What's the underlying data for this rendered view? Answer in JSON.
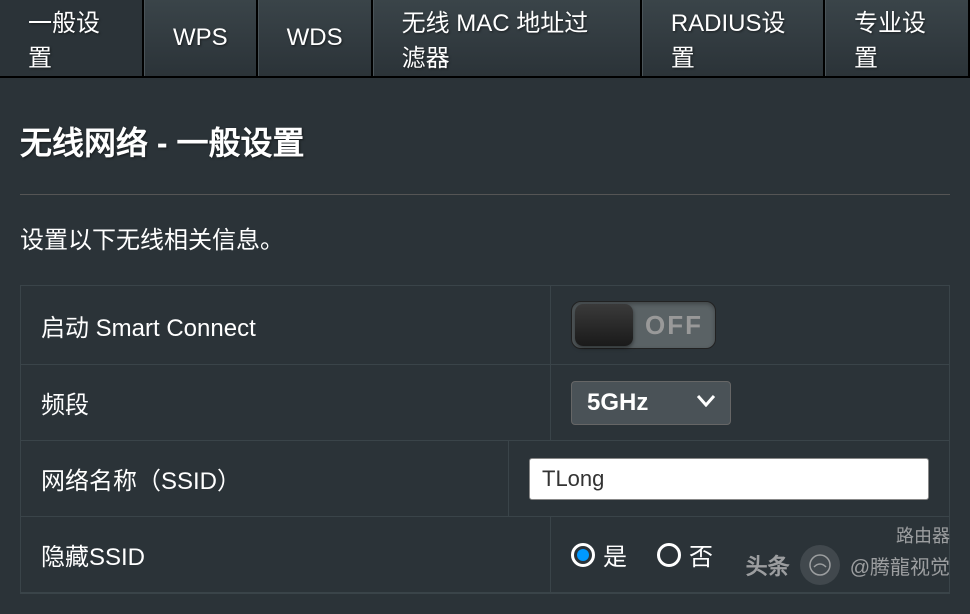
{
  "tabs": [
    {
      "label": "一般设置",
      "active": true
    },
    {
      "label": "WPS",
      "active": false
    },
    {
      "label": "WDS",
      "active": false
    },
    {
      "label": "无线 MAC 地址过滤器",
      "active": false
    },
    {
      "label": "RADIUS设置",
      "active": false
    },
    {
      "label": "专业设置",
      "active": false
    }
  ],
  "page": {
    "title": "无线网络 - 一般设置",
    "description": "设置以下无线相关信息。"
  },
  "settings": {
    "smartConnect": {
      "label": "启动 Smart Connect",
      "state": "OFF"
    },
    "band": {
      "label": "频段",
      "value": "5GHz"
    },
    "ssid": {
      "label": "网络名称（SSID）",
      "value": "TLong"
    },
    "hideSsid": {
      "label": "隐藏SSID",
      "yesLabel": "是",
      "noLabel": "否",
      "selected": "yes"
    }
  },
  "watermark": {
    "brand": "路由器",
    "text1": "头条",
    "text2": "@腾龍视觉"
  }
}
